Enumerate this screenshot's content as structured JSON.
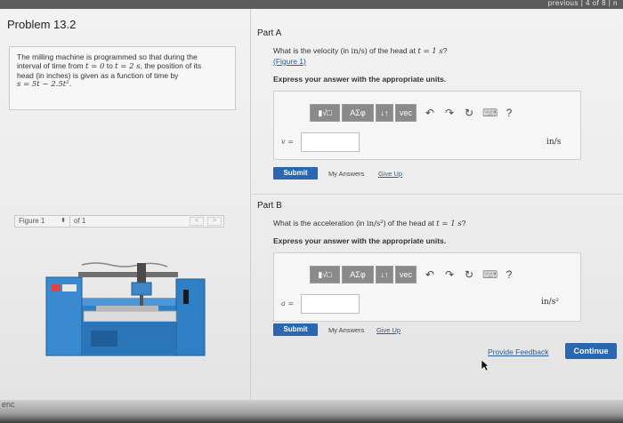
{
  "topbar": {
    "nav_text": "previous | 4 of 8 | n"
  },
  "problem": {
    "title": "Problem 13.2",
    "line1": "The milling machine is programmed so that during the",
    "line2_a": "interval of time from ",
    "line2_eq1": "t = 0",
    "line2_b": " to ",
    "line2_eq2": "t = 2 s",
    "line2_c": ", the position of its",
    "line3": "head (in inches) is given as a function of time by",
    "equation": "s = 5t − 2.5t²."
  },
  "figure": {
    "select_label": "Figure 1",
    "of_label": "of 1",
    "prev": "<",
    "next": ">"
  },
  "partA": {
    "label": "Part A",
    "q_a": "What is the velocity (in ",
    "q_unit": "in/s",
    "q_b": ") of the head at ",
    "q_eq": "t = 1 s",
    "q_c": "?",
    "fig_link": "(Figure 1)",
    "instruction": "Express your answer with the appropriate units.",
    "var_label": "v =",
    "unit": "in/s",
    "submit": "Submit",
    "my_answers": "My Answers",
    "give_up": "Give Up"
  },
  "partB": {
    "label": "Part B",
    "q_a": "What is the acceleration (in ",
    "q_unit": "in/s²",
    "q_b": ") of the head at ",
    "q_eq": "t = 1 s",
    "q_c": "?",
    "instruction": "Express your answer with the appropriate units.",
    "var_label": "a =",
    "unit": "in/s²",
    "submit": "Submit",
    "my_answers": "My Answers",
    "give_up": "Give Up"
  },
  "toolbar": {
    "template": "▮√□",
    "greek": "ΑΣφ",
    "sort": "↓↑",
    "vec": "vec",
    "undo": "↶",
    "redo": "↷",
    "reset": "↻",
    "keyboard": "⌨",
    "help": "?"
  },
  "footer": {
    "feedback": "Provide Feedback",
    "continue": "Continue",
    "corner_text": "enc"
  }
}
